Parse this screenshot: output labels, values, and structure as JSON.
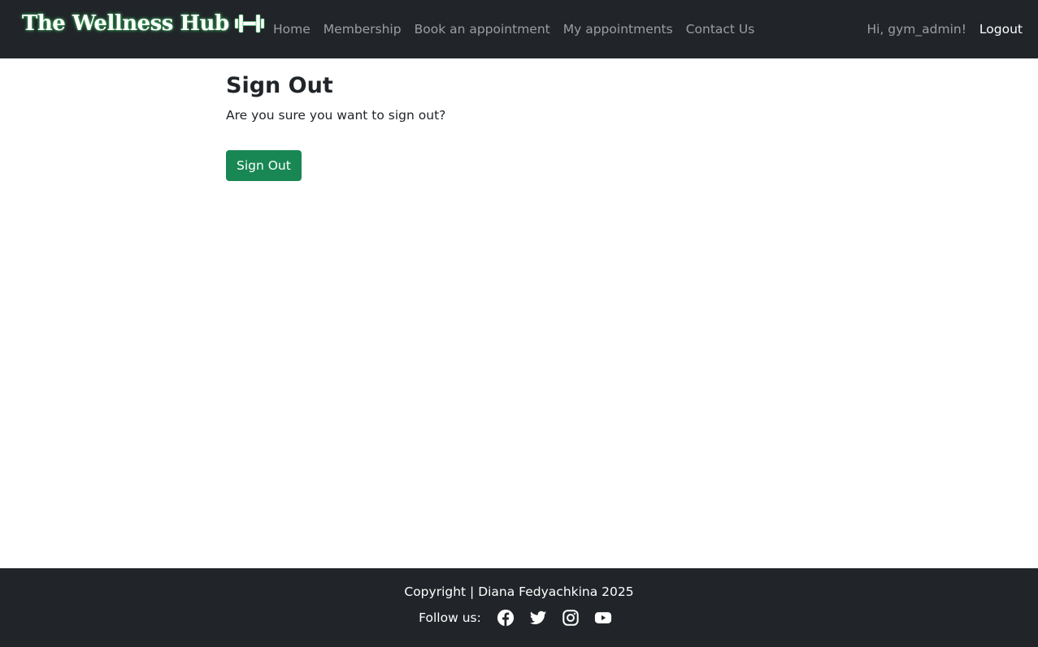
{
  "navbar": {
    "brand": "The Wellness Hub",
    "brand_icon": "dumbbell-icon",
    "links": [
      "Home",
      "Membership",
      "Book an appointment",
      "My appointments",
      "Contact Us"
    ],
    "greeting": "Hi, gym_admin!",
    "logout": "Logout"
  },
  "main": {
    "title": "Sign Out",
    "message": "Are you sure you want to sign out?",
    "button": "Sign Out"
  },
  "footer": {
    "copyright": "Copyright | Diana Fedyachkina 2025",
    "follow_label": "Follow us:",
    "social_icons": [
      "facebook-icon",
      "twitter-icon",
      "instagram-icon",
      "youtube-icon"
    ]
  },
  "colors": {
    "navbar_bg": "#212529",
    "button_green": "#198754",
    "brand_glow": "#3fbf5f"
  }
}
